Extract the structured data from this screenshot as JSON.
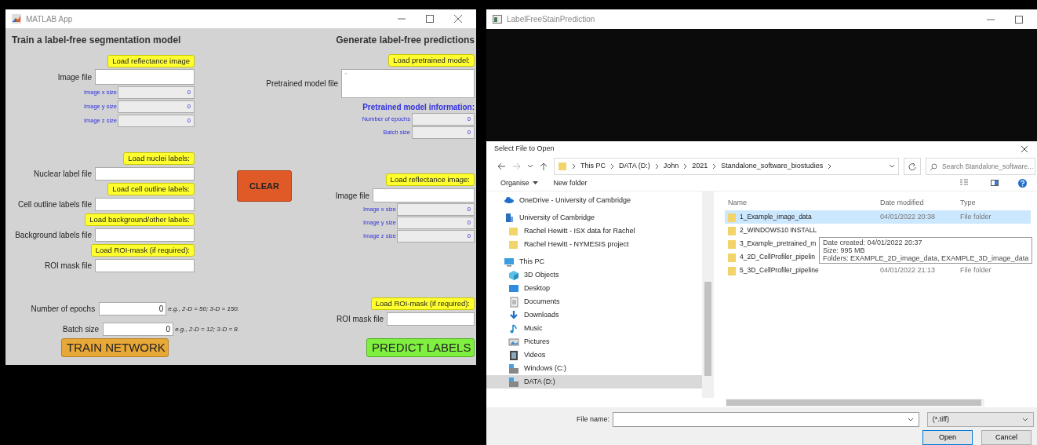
{
  "matlab_window": {
    "title": "MATLAB App",
    "train": {
      "title": "Train a label-free segmentation model",
      "reflectance": {
        "button": "Load reflectance image",
        "file_label": "Image file",
        "sizes": [
          {
            "label": "Image x size",
            "value": "0"
          },
          {
            "label": "Image y size",
            "value": "0"
          },
          {
            "label": "Image z size",
            "value": "0"
          }
        ]
      },
      "labels": [
        {
          "button": "Load nuclei labels:",
          "file_label": "Nuclear label file"
        },
        {
          "button": "Load cell outline labels:",
          "file_label": "Cell outline labels file"
        },
        {
          "button": "Load background/other labels:",
          "file_label": "Background labels file"
        },
        {
          "button": "Load ROI-mask (if required):",
          "file_label": "ROI mask file"
        }
      ],
      "params": [
        {
          "label": "Number of epochs",
          "value": "0",
          "hint": "e.g., 2-D = 50; 3-D = 150."
        },
        {
          "label": "Batch size",
          "value": "0",
          "hint": "e.g., 2-D = 12; 3-D = 8."
        }
      ],
      "train_button": "TRAIN NETWORK"
    },
    "clear_button": "CLEAR",
    "predict": {
      "title": "Generate label-free predictions",
      "model": {
        "button": "Load pretrained model:",
        "file_label": "Pretrained model file",
        "file_value": "''",
        "info_title": "Pretrained model information:",
        "info": [
          {
            "label": "Number of epochs",
            "value": "0"
          },
          {
            "label": "Batch size",
            "value": "0"
          }
        ]
      },
      "reflectance": {
        "button": "Load reflectance image:",
        "file_label": "Image file",
        "sizes": [
          {
            "label": "Image x size",
            "value": "0"
          },
          {
            "label": "Image y size",
            "value": "0"
          },
          {
            "label": "Image z size",
            "value": "0"
          }
        ]
      },
      "roi": {
        "button": "Load ROI-mask (if required):",
        "file_label": "ROI mask file"
      },
      "predict_button": "PREDICT LABELS"
    }
  },
  "prediction_window": {
    "title": "LabelFreeStainPrediction"
  },
  "file_dialog": {
    "title": "Select File to Open",
    "path": [
      "This PC",
      "DATA (D:)",
      "John",
      "2021",
      "Standalone_software_biostudies"
    ],
    "search": {
      "placeholder": "Search Standalone_software..."
    },
    "toolbar": [
      "Organise",
      "New folder"
    ],
    "nav": [
      {
        "label": "OneDrive - University of Cambridge",
        "kind": "cloud",
        "selected": false
      },
      {
        "label": "University of Cambridge",
        "kind": "building",
        "selected": false,
        "children": [
          {
            "label": "Rachel Hewitt - ISX data for Rachel",
            "kind": "folder",
            "selected": false
          },
          {
            "label": "Rachel Hewitt - NYMESIS project",
            "kind": "folder",
            "selected": false
          }
        ]
      },
      {
        "label": "This PC",
        "kind": "pc",
        "selected": false,
        "children": [
          {
            "label": "3D Objects",
            "kind": "objects",
            "selected": false
          },
          {
            "label": "Desktop",
            "kind": "desktop",
            "selected": false
          },
          {
            "label": "Documents",
            "kind": "documents",
            "selected": false
          },
          {
            "label": "Downloads",
            "kind": "downloads",
            "selected": false
          },
          {
            "label": "Music",
            "kind": "music",
            "selected": false
          },
          {
            "label": "Pictures",
            "kind": "pictures",
            "selected": false
          },
          {
            "label": "Videos",
            "kind": "videos",
            "selected": false
          },
          {
            "label": "Windows (C:)",
            "kind": "drive",
            "selected": false
          },
          {
            "label": "DATA (D:)",
            "kind": "drive",
            "selected": true
          }
        ]
      }
    ],
    "columns": [
      "Name",
      "Date modified",
      "Type"
    ],
    "files": [
      {
        "name": "1_Example_image_data",
        "date": "04/01/2022 20:38",
        "type": "File folder",
        "selected": true
      },
      {
        "name": "2_WINDOWS10 INSTALL",
        "selected": false
      },
      {
        "name": "3_Example_pretrained_m",
        "selected": false
      },
      {
        "name": "4_2D_CellProfiler_pipelin",
        "selected": false
      },
      {
        "name": "5_3D_CellProfiler_pipeline",
        "date": "04/01/2022 21:13",
        "type": "File folder",
        "selected": false
      }
    ],
    "tooltip": [
      "Date created: 04/01/2022 20:37",
      "Size: 995 MB",
      "Folders: EXAMPLE_2D_image_data, EXAMPLE_3D_image_data"
    ],
    "file_name_label": "File name:",
    "filter": "(*.tiff)",
    "buttons": [
      {
        "label": "Open",
        "default": true
      },
      {
        "label": "Cancel",
        "default": false
      }
    ]
  }
}
